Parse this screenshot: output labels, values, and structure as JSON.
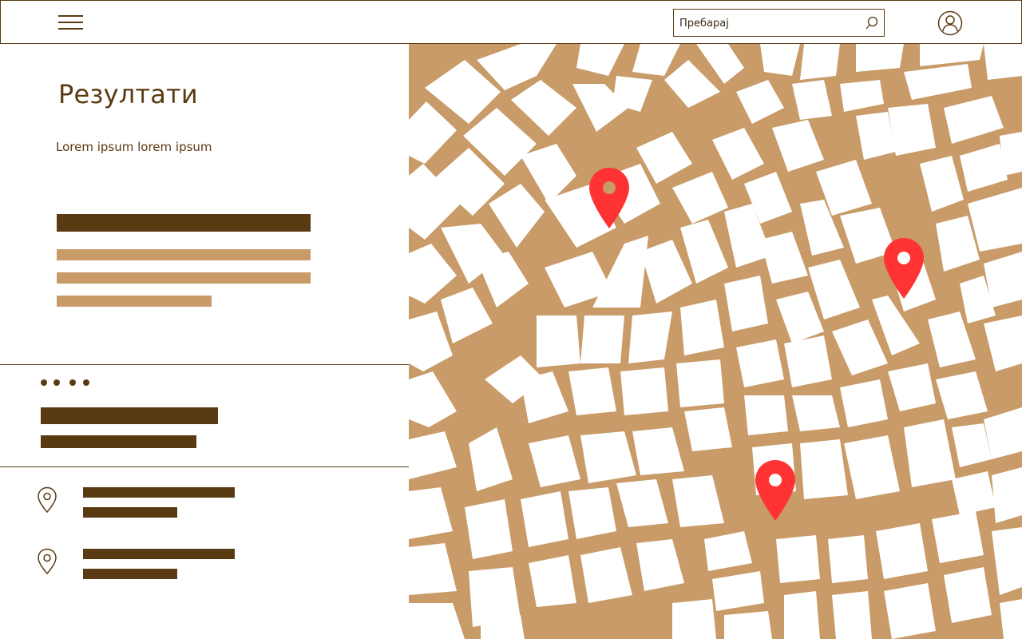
{
  "header": {
    "menu_icon": "hamburger-menu-icon",
    "search": {
      "placeholder": "Пребарај",
      "icon": "search-icon"
    },
    "profile_icon": "user-profile-icon"
  },
  "results": {
    "title": "Резултати",
    "subtitle": "Lorem ipsum lorem ipsum"
  },
  "locations": [
    {
      "icon": "location-pin-icon"
    },
    {
      "icon": "location-pin-icon"
    }
  ],
  "map": {
    "marker_icon": "map-marker-icon",
    "marker_count": 3
  },
  "colors": {
    "brown": "#5a3a12",
    "tan": "#c89b68",
    "marker_red": "#ff3333",
    "background": "#ffffff"
  }
}
